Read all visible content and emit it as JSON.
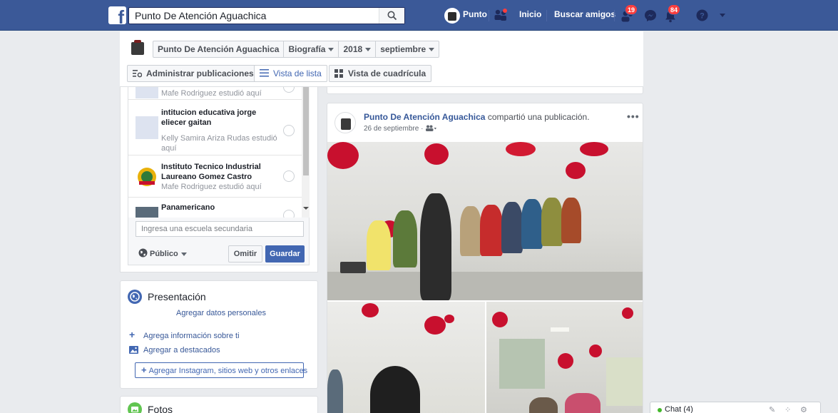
{
  "topbar": {
    "search_value": "Punto De Atención Aguachica",
    "profile_name": "Punto",
    "home_label": "Inicio",
    "find_friends_label": "Buscar amigos",
    "friend_requests_count": "19",
    "notifications_count": "84",
    "brand_color": "#3b5998"
  },
  "timeline_nav": {
    "page_name": "Punto De Atención Aguachica",
    "section": "Biografía",
    "year": "2018",
    "month": "septiembre",
    "manage_posts_label": "Administrar publicaciones",
    "list_view_label": "Vista de lista",
    "grid_view_label": "Vista de cuadrícula"
  },
  "education": {
    "items": [
      {
        "name": "",
        "subtitle": "Mafe Rodriguez estudió aquí"
      },
      {
        "name": "intitucion educativa jorge eliecer gaitan",
        "subtitle": "Kelly Samira Ariza Rudas estudió aquí"
      },
      {
        "name": "Instituto Tecnico Industrial Laureano Gomez Castro",
        "subtitle": "Mafe Rodriguez estudió aquí"
      },
      {
        "name": "Panamericano",
        "subtitle": ""
      }
    ],
    "input_placeholder": "Ingresa una escuela secundaria",
    "privacy_label": "Público",
    "skip_label": "Omitir",
    "save_label": "Guardar"
  },
  "intro": {
    "title": "Presentación",
    "add_personal_data": "Agregar datos personales",
    "add_info": "Agrega información sobre ti",
    "add_featured": "Agregar a destacados",
    "add_links": "Agregar Instagram, sitios web y otros enlaces"
  },
  "photos": {
    "title": "Fotos"
  },
  "post": {
    "author": "Punto De Atención Aguachica",
    "action": "compartió una publicación.",
    "date": "26 de septiembre",
    "more_label": "•••"
  },
  "chat": {
    "label": "Chat (4)"
  }
}
